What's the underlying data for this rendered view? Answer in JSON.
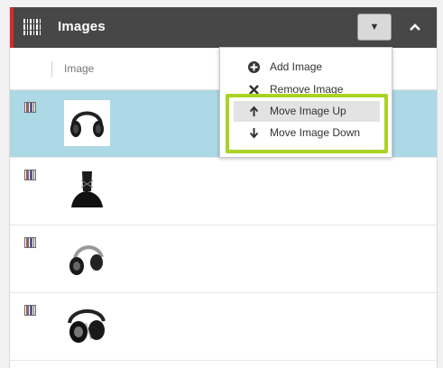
{
  "panel": {
    "title": "Images",
    "accent_color": "#d72b2b",
    "header_bg": "#474747",
    "icon": "grid-barcode-icon",
    "dropdown_icon": "triangle-down-icon",
    "collapse_icon": "chevron-up-icon"
  },
  "table": {
    "column_header": "Image",
    "rows": [
      {
        "icon": "grid-barcode-icon",
        "image": "headphones-over-ear-black",
        "selected": true
      },
      {
        "icon": "grid-barcode-icon",
        "image": "headphones-black-hanging",
        "selected": false
      },
      {
        "icon": "grid-barcode-icon",
        "image": "headphones-folded-silver",
        "selected": false
      },
      {
        "icon": "grid-barcode-icon",
        "image": "headphones-folded-black",
        "selected": false
      }
    ],
    "selected_color": "#add8e6"
  },
  "menu": {
    "items": [
      {
        "label": "Add Image",
        "icon": "plus-circle-icon"
      },
      {
        "label": "Remove Image",
        "icon": "x-icon"
      },
      {
        "label": "Move Image Up",
        "icon": "arrow-up-icon"
      },
      {
        "label": "Move Image Down",
        "icon": "arrow-down-icon"
      }
    ],
    "highlight_color": "#a9d323"
  }
}
